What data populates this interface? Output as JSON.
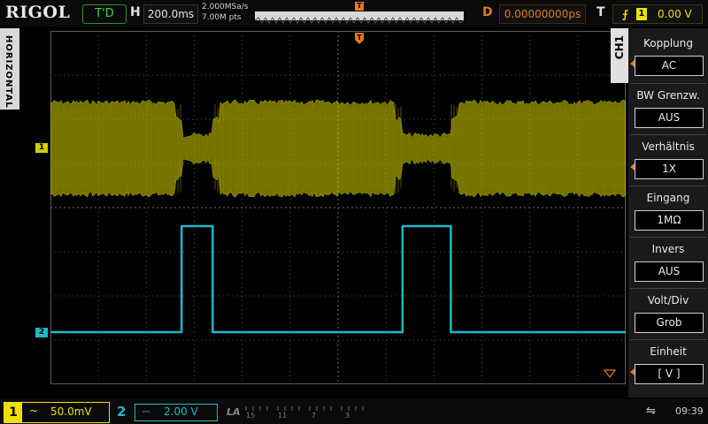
{
  "top": {
    "brand": "RIGOL",
    "run_status": "T'D",
    "h_label": "H",
    "timebase": "200.0ms",
    "sample_rate": "2.000MSa/s",
    "memory_depth": "7.00M pts",
    "delay_label": "D",
    "delay": "0.00000000ps",
    "trigger_label": "T",
    "trigger_source": "1",
    "trigger_level": "0.00 V"
  },
  "side_tab": "HORIZONTAL",
  "channel_tab": "CH1",
  "menu": [
    {
      "title": "Kopplung",
      "value": "AC"
    },
    {
      "title": "BW Grenzw.",
      "value": "AUS"
    },
    {
      "title": "Verhältnis",
      "value": "1X"
    },
    {
      "title": "Eingang",
      "value": "1MΩ"
    },
    {
      "title": "Invers",
      "value": "AUS"
    },
    {
      "title": "Volt/Div",
      "value": "Grob"
    },
    {
      "title": "Einheit",
      "value": "[ V ]"
    }
  ],
  "bottom": {
    "ch1_num": "1",
    "ch1_coupling": "~",
    "ch1_scale": "50.0mV",
    "ch2_num": "2",
    "ch2_coupling": "⎓",
    "ch2_scale": "2.00 V",
    "la_label": "LA",
    "la_ticks": [
      "15",
      "11",
      "7",
      "3"
    ],
    "time": "09:39"
  },
  "markers": {
    "ch1": "1",
    "ch2": "2"
  },
  "colors": {
    "ch1": "#d4d000",
    "ch2": "#1fb8c8",
    "trigger": "#e07a1e",
    "grid": "#5a5a5a"
  },
  "signals": {
    "ch1_description": "burst envelope: high amplitude when CH2 low, low amplitude when CH2 high",
    "ch2_high_segments_fraction": [
      [
        0.228,
        0.282
      ],
      [
        0.612,
        0.696
      ]
    ]
  }
}
